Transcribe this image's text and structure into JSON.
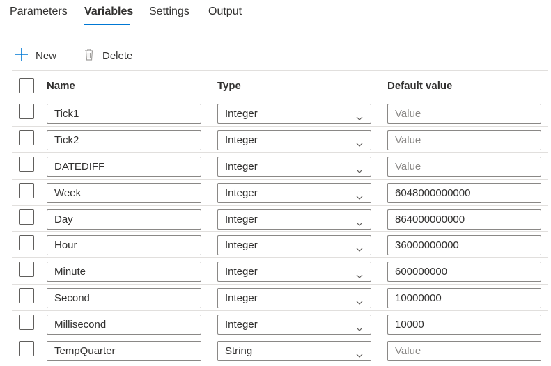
{
  "tabs": [
    {
      "label": "Parameters",
      "active": false
    },
    {
      "label": "Variables",
      "active": true
    },
    {
      "label": "Settings",
      "active": false
    },
    {
      "label": "Output",
      "active": false
    }
  ],
  "toolbar": {
    "new_label": "New",
    "delete_label": "Delete",
    "new_icon": "plus-icon",
    "delete_icon": "trash-icon"
  },
  "table": {
    "headers": {
      "name": "Name",
      "type": "Type",
      "default": "Default value"
    },
    "value_placeholder": "Value",
    "rows": [
      {
        "name": "Tick1",
        "type": "Integer",
        "default": ""
      },
      {
        "name": "Tick2",
        "type": "Integer",
        "default": ""
      },
      {
        "name": "DATEDIFF",
        "type": "Integer",
        "default": ""
      },
      {
        "name": "Week",
        "type": "Integer",
        "default": "6048000000000"
      },
      {
        "name": "Day",
        "type": "Integer",
        "default": "864000000000"
      },
      {
        "name": "Hour",
        "type": "Integer",
        "default": "36000000000"
      },
      {
        "name": "Minute",
        "type": "Integer",
        "default": "600000000"
      },
      {
        "name": "Second",
        "type": "Integer",
        "default": "10000000"
      },
      {
        "name": "Millisecond",
        "type": "Integer",
        "default": "10000"
      },
      {
        "name": "TempQuarter",
        "type": "String",
        "default": ""
      }
    ]
  },
  "colors": {
    "accent": "#0078d4",
    "text": "#323130",
    "border": "#8a8886"
  }
}
